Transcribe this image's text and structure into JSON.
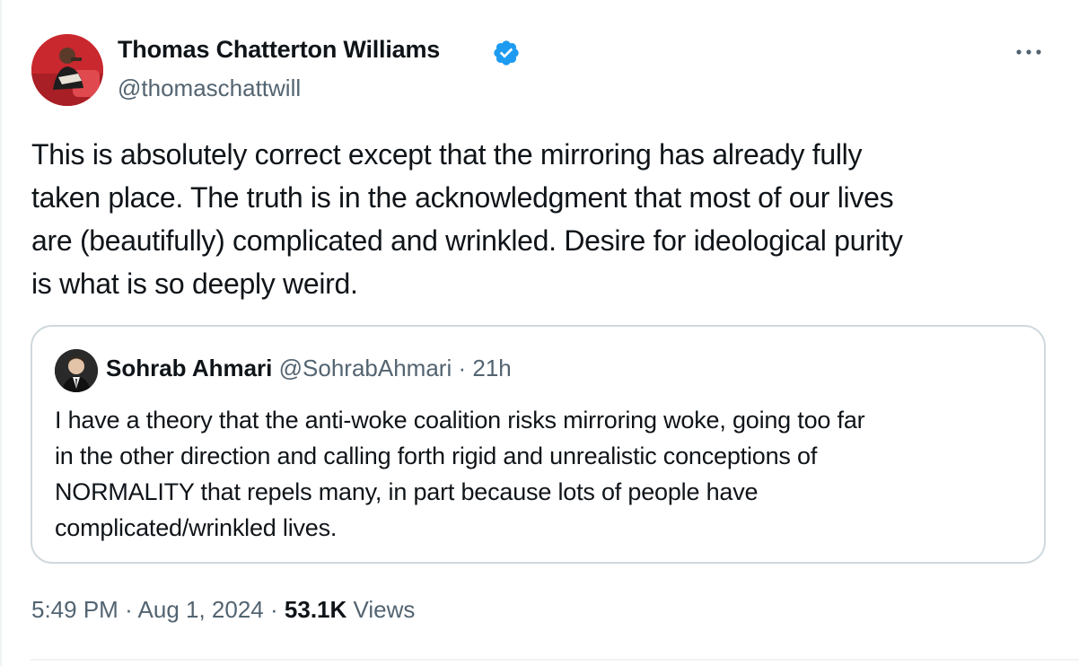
{
  "tweet": {
    "author": {
      "name": "Thomas Chatterton Williams",
      "handle": "@thomaschattwill",
      "verified": true,
      "avatar_icon": "profile-photo"
    },
    "more_icon": "more-horizontal-icon",
    "text": "This is absolutely correct except that the mirroring has already fully\ntaken place. The truth is in the acknowledgment that most of our lives\nare (beautifully) complicated and wrinkled. Desire for ideological purity\nis what is so deeply weird.",
    "quoted": {
      "name": "Sohrab Ahmari",
      "handle": "@SohrabAhmari",
      "separator": "·",
      "time": "21h",
      "text": "I have a theory that the anti-woke coalition risks mirroring woke, going too far\nin the other direction and calling forth rigid and unrealistic conceptions of\nNORMALITY that repels many, in part because lots of people have\ncomplicated/wrinkled lives."
    },
    "meta": {
      "time": "5:49 PM",
      "separator": "·",
      "date": "Aug 1, 2024",
      "views_count": "53.1K",
      "views_label": "Views"
    }
  },
  "colors": {
    "text_primary": "#0f1419",
    "text_secondary": "#536471",
    "verified_blue": "#1d9bf0",
    "border": "#cfd9de",
    "divider": "#eff3f4"
  }
}
